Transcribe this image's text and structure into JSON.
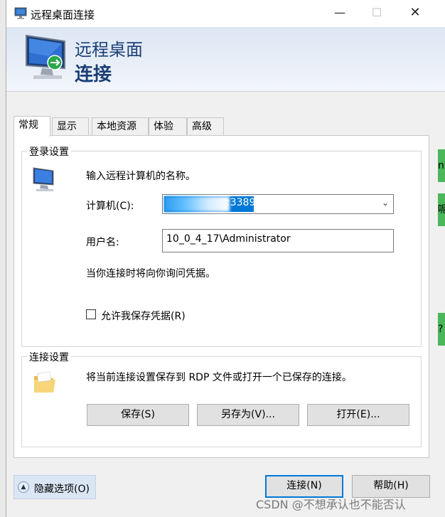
{
  "window": {
    "title": "远程桌面连接",
    "minimize": "—",
    "maximize": "☐",
    "close": "✕"
  },
  "banner": {
    "line1": "远程桌面",
    "line2": "连接"
  },
  "tabs": [
    {
      "label": "常规",
      "active": true
    },
    {
      "label": "显示"
    },
    {
      "label": "本地资源"
    },
    {
      "label": "体验"
    },
    {
      "label": "高级"
    }
  ],
  "login": {
    "legend": "登录设置",
    "instruction": "输入远程计算机的名称。",
    "computer_label": "计算机(C):",
    "computer_value": ":3389",
    "username_label": "用户名:",
    "username_value": "10_0_4_17\\Administrator",
    "credential_note": "当你连接时将向你询问凭据。",
    "save_credentials_label": "允许我保存凭据(R)",
    "save_credentials_checked": false
  },
  "connection": {
    "legend": "连接设置",
    "description": "将当前连接设置保存到 RDP 文件或打开一个已保存的连接。",
    "save_label": "保存(S)",
    "save_as_label": "另存为(V)...",
    "open_label": "打开(E)..."
  },
  "footer": {
    "hide_options_label": "隐藏选项(O)",
    "connect_label": "连接(N)",
    "help_label": "帮助(H)"
  },
  "side_fragments": [
    "n",
    "呢",
    "?"
  ],
  "watermark": "CSDN @不想承认也不能否认",
  "colors": {
    "banner_text": "#1b3f77",
    "selection": "#0078d7",
    "accent_green": "#4bb65a"
  }
}
